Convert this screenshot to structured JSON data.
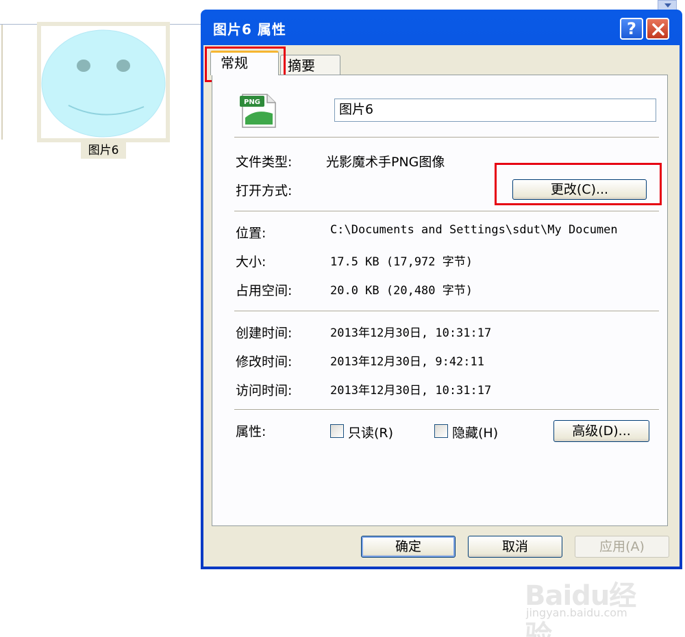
{
  "explorer": {
    "thumbnail_label": "图片6"
  },
  "dialog": {
    "title": "图片6 属性",
    "help_glyph": "?",
    "tabs": [
      {
        "label": "常规"
      },
      {
        "label": "摘要"
      }
    ],
    "file_name_value": "图片6",
    "png_icon_text": "PNG",
    "rows": {
      "file_type_label": "文件类型:",
      "file_type_value": "光影魔术手PNG图像",
      "open_with_label": "打开方式:",
      "change_button": "更改(C)...",
      "location_label": "位置:",
      "location_value": "C:\\Documents and Settings\\sdut\\My Documen",
      "size_label": "大小:",
      "size_value": "17.5 KB (17,972 字节)",
      "disk_size_label": "占用空间:",
      "disk_size_value": "20.0 KB (20,480 字节)",
      "created_label": "创建时间:",
      "created_value": "2013年12月30日, 10:31:17",
      "modified_label": "修改时间:",
      "modified_value": "2013年12月30日, 9:42:11",
      "accessed_label": "访问时间:",
      "accessed_value": "2013年12月30日, 10:31:17",
      "attributes_label": "属性:",
      "readonly_label": "只读(R)",
      "hidden_label": "隐藏(H)",
      "advanced_button": "高级(D)..."
    },
    "buttons": {
      "ok": "确定",
      "cancel": "取消",
      "apply": "应用(A)"
    }
  },
  "watermark": {
    "logo": "Baidu经验",
    "url": "jingyan.baidu.com"
  },
  "colors": {
    "highlight_red": "#e60012",
    "titlebar_blue": "#0a5ae6",
    "smiley_fill": "#c6f4fb"
  }
}
